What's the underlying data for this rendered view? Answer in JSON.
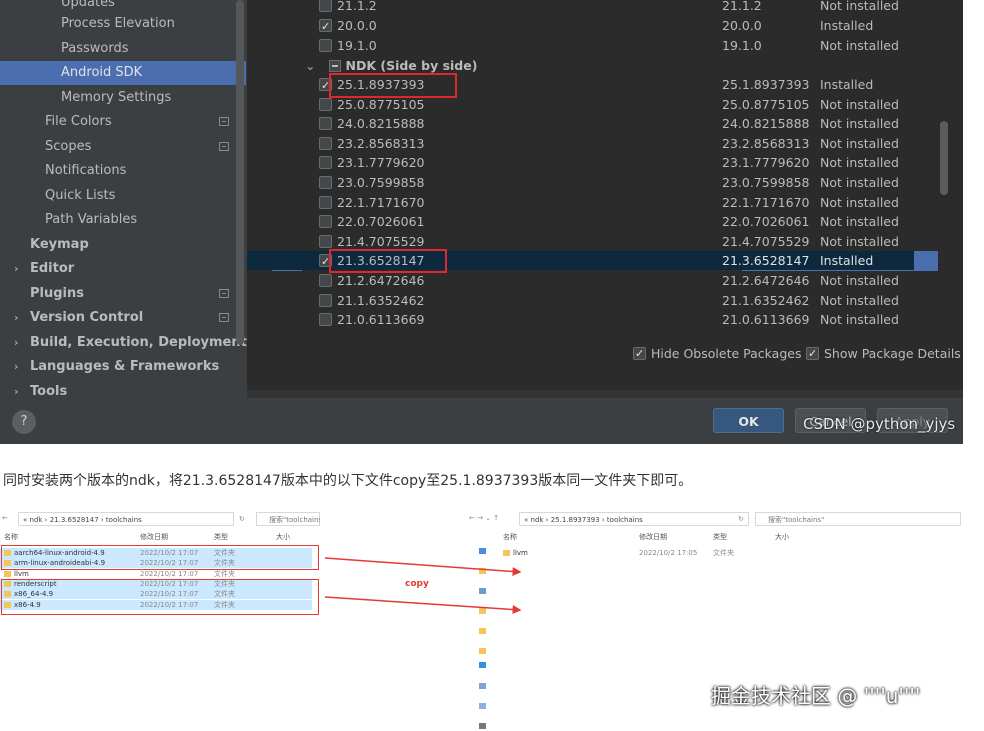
{
  "sidebar": {
    "items": [
      {
        "label": "Updates",
        "indent": 61,
        "bold": false,
        "arrow": false,
        "badge": false
      },
      {
        "label": "Process Elevation",
        "indent": 61,
        "bold": false,
        "arrow": false,
        "badge": false
      },
      {
        "label": "Passwords",
        "indent": 61,
        "bold": false,
        "arrow": false,
        "badge": false
      },
      {
        "label": "Android SDK",
        "indent": 61,
        "bold": false,
        "arrow": false,
        "badge": false,
        "selected": true
      },
      {
        "label": "Memory Settings",
        "indent": 61,
        "bold": false,
        "arrow": false,
        "badge": false
      },
      {
        "label": "File Colors",
        "indent": 45,
        "bold": false,
        "arrow": false,
        "badge": true
      },
      {
        "label": "Scopes",
        "indent": 45,
        "bold": false,
        "arrow": false,
        "badge": true
      },
      {
        "label": "Notifications",
        "indent": 45,
        "bold": false,
        "arrow": false,
        "badge": false
      },
      {
        "label": "Quick Lists",
        "indent": 45,
        "bold": false,
        "arrow": false,
        "badge": false
      },
      {
        "label": "Path Variables",
        "indent": 45,
        "bold": false,
        "arrow": false,
        "badge": false
      },
      {
        "label": "Keymap",
        "indent": 30,
        "bold": true,
        "arrow": false,
        "badge": false
      },
      {
        "label": "Editor",
        "indent": 30,
        "bold": true,
        "arrow": true,
        "badge": false
      },
      {
        "label": "Plugins",
        "indent": 30,
        "bold": true,
        "arrow": false,
        "badge": true
      },
      {
        "label": "Version Control",
        "indent": 30,
        "bold": true,
        "arrow": true,
        "badge": true
      },
      {
        "label": "Build, Execution, Deployment",
        "indent": 30,
        "bold": true,
        "arrow": true,
        "badge": false
      },
      {
        "label": "Languages & Frameworks",
        "indent": 30,
        "bold": true,
        "arrow": true,
        "badge": false
      },
      {
        "label": "Tools",
        "indent": 30,
        "bold": true,
        "arrow": true,
        "badge": false
      }
    ]
  },
  "sdk_table": {
    "top_rows": [
      {
        "name": "21.1.2",
        "version": "21.1.2",
        "status": "Not installed",
        "checked": false
      },
      {
        "name": "20.0.0",
        "version": "20.0.0",
        "status": "Installed",
        "checked": true
      },
      {
        "name": "19.1.0",
        "version": "19.1.0",
        "status": "Not installed",
        "checked": false
      }
    ],
    "group_label": "NDK (Side by side)",
    "ndk_rows": [
      {
        "name": "25.1.8937393",
        "version": "25.1.8937393",
        "status": "Installed",
        "checked": true
      },
      {
        "name": "25.0.8775105",
        "version": "25.0.8775105",
        "status": "Not installed",
        "checked": false
      },
      {
        "name": "24.0.8215888",
        "version": "24.0.8215888",
        "status": "Not installed",
        "checked": false
      },
      {
        "name": "23.2.8568313",
        "version": "23.2.8568313",
        "status": "Not installed",
        "checked": false
      },
      {
        "name": "23.1.7779620",
        "version": "23.1.7779620",
        "status": "Not installed",
        "checked": false
      },
      {
        "name": "23.0.7599858",
        "version": "23.0.7599858",
        "status": "Not installed",
        "checked": false
      },
      {
        "name": "22.1.7171670",
        "version": "22.1.7171670",
        "status": "Not installed",
        "checked": false
      },
      {
        "name": "22.0.7026061",
        "version": "22.0.7026061",
        "status": "Not installed",
        "checked": false
      },
      {
        "name": "21.4.7075529",
        "version": "21.4.7075529",
        "status": "Not installed",
        "checked": false
      },
      {
        "name": "21.3.6528147",
        "version": "21.3.6528147",
        "status": "Installed",
        "checked": true,
        "selected": true
      },
      {
        "name": "21.2.6472646",
        "version": "21.2.6472646",
        "status": "Not installed",
        "checked": false
      },
      {
        "name": "21.1.6352462",
        "version": "21.1.6352462",
        "status": "Not installed",
        "checked": false
      },
      {
        "name": "21.0.6113669",
        "version": "21.0.6113669",
        "status": "Not installed",
        "checked": false
      }
    ]
  },
  "options": {
    "hide_obsolete": "Hide Obsolete Packages",
    "show_details": "Show Package Details"
  },
  "buttons": {
    "help": "?",
    "ok": "OK",
    "cancel": "Cancel",
    "apply": "Apply"
  },
  "watermark_top": "CSDN @python_yjys",
  "article_text": "同时安装两个版本的ndk，将21.3.6528147版本中的以下文件copy至25.1.8937393版本同一文件夹下即可。",
  "explorer_left": {
    "address": "« ndk  ›  21.3.6528147  ›  toolchains",
    "search": "搜索\"toolchains\"",
    "headers": [
      "名称",
      "修改日期",
      "类型",
      "大小"
    ],
    "files": [
      {
        "name": "aarch64-linux-android-4.9",
        "date": "2022/10/2 17:07",
        "type": "文件夹",
        "sel": true
      },
      {
        "name": "arm-linux-androideabi-4.9",
        "date": "2022/10/2 17:07",
        "type": "文件夹",
        "sel": true
      },
      {
        "name": "llvm",
        "date": "2022/10/2 17:07",
        "type": "文件夹",
        "sel": false
      },
      {
        "name": "renderscript",
        "date": "2022/10/2 17:07",
        "type": "文件夹",
        "sel": true
      },
      {
        "name": "x86_64-4.9",
        "date": "2022/10/2 17:07",
        "type": "文件夹",
        "sel": true
      },
      {
        "name": "x86-4.9",
        "date": "2022/10/2 17:07",
        "type": "文件夹",
        "sel": true
      }
    ]
  },
  "explorer_right": {
    "address": "« ndk  ›  25.1.8937393  ›  toolchains",
    "search": "搜索\"toolchains\"",
    "headers": [
      "名称",
      "修改日期",
      "类型",
      "大小"
    ],
    "files": [
      {
        "name": "llvm",
        "date": "2022/10/2 17:05",
        "type": "文件夹",
        "sel": false
      }
    ]
  },
  "copy_label": "copy",
  "watermark_bottom": "掘金技术社区 @ ''''u''''"
}
